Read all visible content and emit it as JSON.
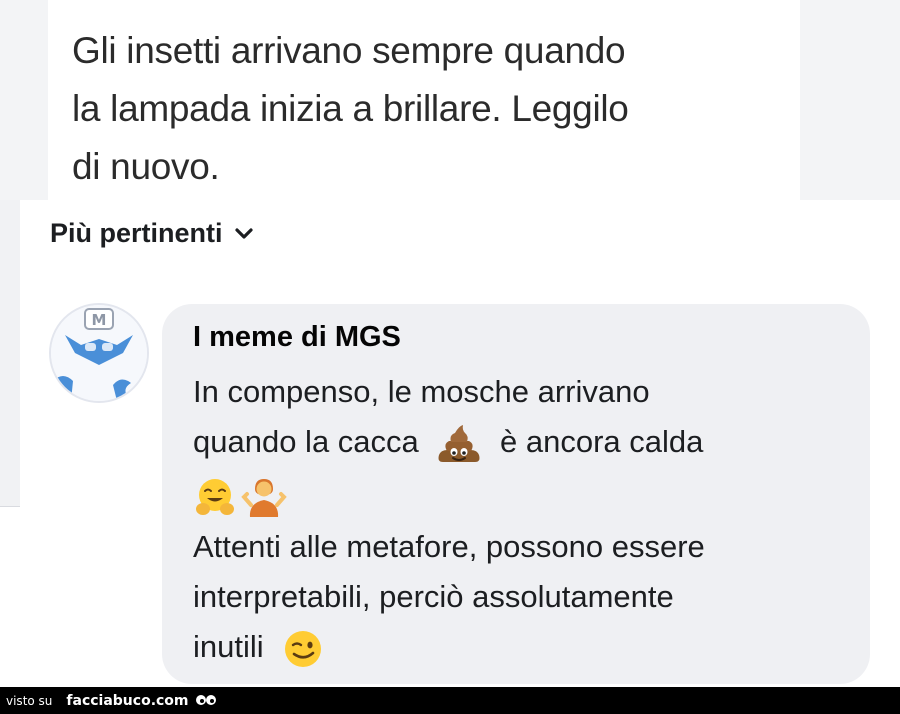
{
  "post": {
    "lines": [
      "Gli insetti arrivano sempre quando",
      "la lampada inizia a brillare. Leggilo",
      "di nuovo."
    ]
  },
  "sort": {
    "label": "Più pertinenti",
    "icon": "chevron-down-icon"
  },
  "comment": {
    "author": "I meme di MGS",
    "avatar_badge": "M",
    "line1": "In compenso, le mosche arrivano",
    "line2_a": "quando la cacca",
    "line2_b": "è ancora calda",
    "line4": "Attenti alle metafore, possono essere",
    "line5": "interpretabili, perciò assolutamente",
    "line6": "inutili",
    "emojis": [
      "pile-of-poo",
      "hugging-face",
      "person-shrugging",
      "winking-face"
    ]
  },
  "footer": {
    "prefix": "visto su",
    "site": "facciabuco.com"
  },
  "colors": {
    "bubble": "#eff0f3",
    "text": "#1c1e21",
    "avatar_blue": "#4a8fd8"
  }
}
